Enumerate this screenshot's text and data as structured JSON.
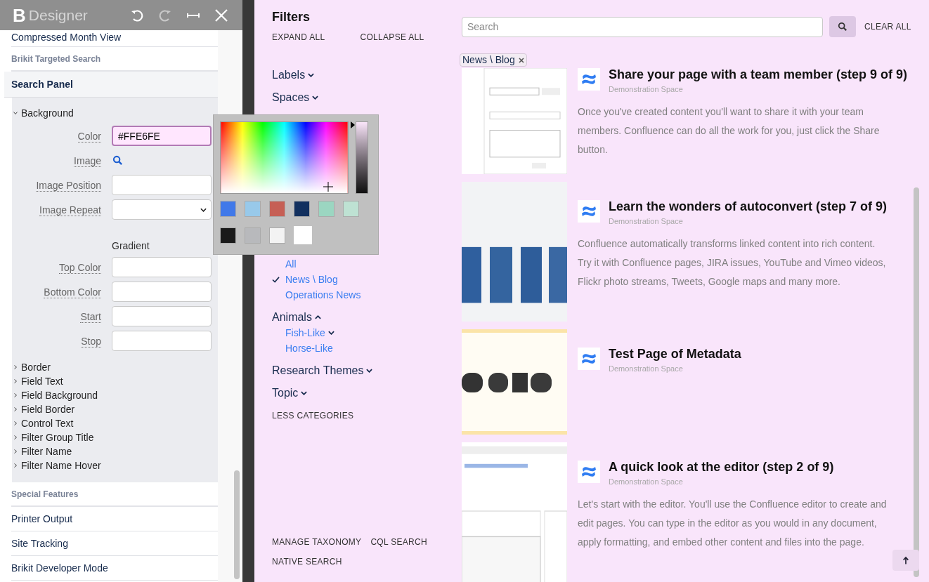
{
  "designer": {
    "logo": "B",
    "title": "Designer",
    "nav_top": [
      {
        "kind": "item",
        "label": "Compressed Month View"
      },
      {
        "kind": "heading",
        "label": "Brikit Targeted Search"
      }
    ],
    "section": {
      "label": "Search Panel",
      "groups": [
        {
          "label": "Background",
          "expanded": true,
          "fields": [
            {
              "kind": "color",
              "label": "Color",
              "value": "#FFE6FE"
            },
            {
              "label": "Image"
            },
            {
              "kind": "text",
              "label": "Image Position"
            },
            {
              "kind": "select",
              "label": "Image Repeat"
            },
            {
              "kind": "subhead",
              "label": "Gradient"
            },
            {
              "kind": "text",
              "label": "Top Color"
            },
            {
              "kind": "text",
              "label": "Bottom Color"
            },
            {
              "kind": "text",
              "label": "Start"
            },
            {
              "kind": "text",
              "label": "Stop"
            }
          ]
        },
        {
          "label": "Border",
          "expanded": false
        },
        {
          "label": "Field Text",
          "expanded": false
        },
        {
          "label": "Field Background",
          "expanded": false
        },
        {
          "label": "Field Border",
          "expanded": false
        },
        {
          "label": "Control Text",
          "expanded": false
        },
        {
          "label": "Filter Group Title",
          "expanded": false
        },
        {
          "label": "Filter Name",
          "expanded": false
        },
        {
          "label": "Filter Name Hover",
          "expanded": false
        }
      ]
    },
    "nav_bottom": [
      {
        "kind": "heading",
        "label": "Special Features"
      },
      {
        "kind": "item",
        "label": "Printer Output"
      },
      {
        "kind": "item",
        "label": "Site Tracking"
      },
      {
        "kind": "item",
        "label": "Brikit Developer Mode"
      }
    ]
  },
  "color_picker": {
    "level": 1,
    "swatches": [
      {
        "color": "#4179e9",
        "selected": false
      },
      {
        "color": "#98c9ea",
        "selected": false
      },
      {
        "color": "#c65f55",
        "selected": false
      },
      {
        "color": "#12305f",
        "selected": false
      },
      {
        "color": "#9bd6c1",
        "selected": false
      },
      {
        "color": "#bee2d3",
        "selected": false
      },
      {
        "color": "#1a1a1a",
        "selected": false
      },
      {
        "color": "#b8b9bc",
        "selected": false
      },
      {
        "color": "#f3f3f3",
        "selected": false
      },
      {
        "color": "#ffffff",
        "selected": true
      }
    ]
  },
  "filters": {
    "title": "Filters",
    "actions": [
      "EXPAND ALL",
      "COLLAPSE ALL"
    ],
    "groups": [
      {
        "label": "Labels",
        "expanded": false
      },
      {
        "label": "Spaces",
        "expanded": false
      },
      {
        "expanded": true,
        "children": [
          {
            "label": "All",
            "selected": false
          },
          {
            "label": "News \\ Blog",
            "selected": true
          },
          {
            "label": "Operations News",
            "selected": false
          }
        ]
      },
      {
        "label": "Animals",
        "expanded": true,
        "children": [
          {
            "label": "Fish-Like",
            "selected": false,
            "expandable": true
          },
          {
            "label": "Horse-Like",
            "selected": false,
            "expandable": false
          }
        ]
      },
      {
        "label": "Research Themes",
        "expanded": false
      },
      {
        "label": "Topic",
        "expanded": false
      }
    ],
    "less_link": "LESS CATEGORIES",
    "footer_links": [
      "MANAGE TAXONOMY",
      "CQL SEARCH",
      "NATIVE SEARCH"
    ]
  },
  "search": {
    "placeholder": "Search",
    "clear_label": "CLEAR ALL"
  },
  "active_tags": [
    {
      "label": "News \\ Blog"
    }
  ],
  "results": [
    {
      "title": "Share your page with a team member (step 9 of 9)",
      "space": "Demonstration Space",
      "description": "Once you've created content you'll want to share it with your team members.  Confluence can do all the work for you, just click the Share button."
    },
    {
      "title": "Learn the wonders of autoconvert (step 7 of 9)",
      "space": "Demonstration Space",
      "description": "Confluence automatically transforms linked content into rich content. Try it with Confluence pages, JIRA issues, YouTube and Vimeo videos,  Flickr photo streams, Tweets, Google maps and many more."
    },
    {
      "title": "Test Page of Metadata",
      "space": "Demonstration Space"
    },
    {
      "title": "A quick look at the editor (step 2 of 9)",
      "space": "Demonstration Space",
      "description": "Let's start with the editor. You'll use the Confluence editor to create and edit pages. You can type in the editor as you would in any document, apply formatting, and embed other content and files into the page."
    }
  ]
}
